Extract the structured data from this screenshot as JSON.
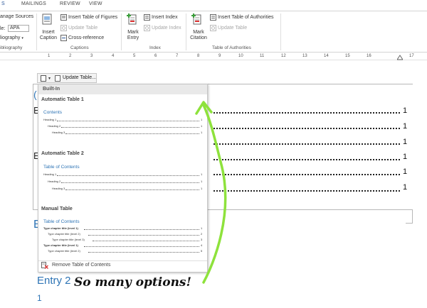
{
  "ribbon": {
    "tabs": [
      "S",
      "MAILINGS",
      "REVIEW",
      "VIEW"
    ],
    "citations": {
      "manage_sources": "anage Sources",
      "style_label": "le:",
      "style_value": "APA",
      "bibliography": "liography",
      "group_label": "ibliography"
    },
    "captions": {
      "insert_caption_line1": "Insert",
      "insert_caption_line2": "Caption",
      "insert_table_of_figures": "Insert Table of Figures",
      "update_table": "Update Table",
      "cross_reference": "Cross-reference",
      "group_label": "Captions"
    },
    "index": {
      "mark_entry_line1": "Mark",
      "mark_entry_line2": "Entry",
      "insert_index": "Insert Index",
      "update_index": "Update Index",
      "group_label": "Index"
    },
    "authorities": {
      "mark_citation_line1": "Mark",
      "mark_citation_line2": "Citation",
      "insert_table_of_authorities": "Insert Table of Authorities",
      "update_table": "Update Table",
      "group_label": "Table of Authorities"
    }
  },
  "ruler": {
    "numbers": [
      "1",
      "2",
      "3",
      "4",
      "5",
      "6",
      "7",
      "8",
      "9",
      "10",
      "11",
      "12",
      "13",
      "14",
      "15",
      "16",
      "17"
    ]
  },
  "content_control": {
    "update_table": "Update Table..."
  },
  "document": {
    "page_numbers": [
      "1",
      "1",
      "1",
      "1",
      "1",
      "1"
    ],
    "left_fragments": [
      "(",
      "E",
      "E"
    ],
    "left_fragment_E": "E",
    "entry2_heading": "Entry 2",
    "entry2_text": "1",
    "accent_color": "#2e74b5"
  },
  "dropdown": {
    "header": "Built-In",
    "automatic_table_1": {
      "title": "Automatic Table 1",
      "heading": "Contents",
      "lines": [
        "Heading 1",
        "Heading 2",
        "Heading 3"
      ],
      "page": "1"
    },
    "automatic_table_2": {
      "title": "Automatic Table 2",
      "heading": "Table of Contents",
      "lines": [
        "Heading 1",
        "Heading 2",
        "Heading 3"
      ],
      "page": "1"
    },
    "manual_table": {
      "title": "Manual Table",
      "heading": "Table of Contents",
      "lines": [
        "Type chapter title (level 1)",
        "Type chapter title (level 2)",
        "Type chapter title (level 3)",
        "Type chapter title (level 1)",
        "Type chapter title (level 2)"
      ],
      "pages": [
        "1",
        "2",
        "3",
        "4",
        "5"
      ]
    },
    "remove_label": "Remove Table of Contents"
  },
  "annotation": {
    "text": "So many options!",
    "arrow_color": "#8ee23c"
  }
}
